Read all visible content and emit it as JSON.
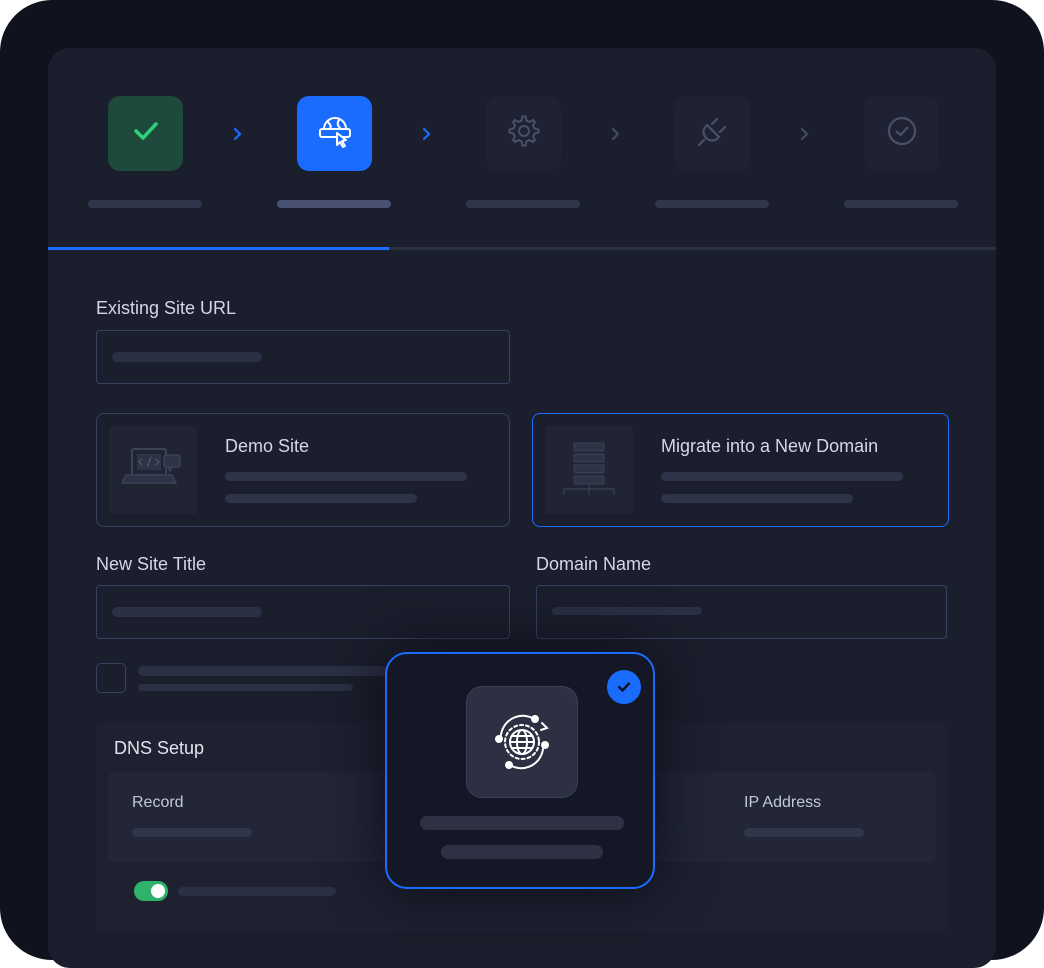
{
  "wizard": {
    "steps": [
      {
        "state": "done",
        "icon": "checkmark-icon"
      },
      {
        "state": "active",
        "icon": "globe-cursor-icon"
      },
      {
        "state": "upcoming",
        "icon": "gear-icon"
      },
      {
        "state": "upcoming",
        "icon": "plug-icon"
      },
      {
        "state": "upcoming",
        "icon": "check-circle-icon"
      }
    ],
    "progress_fraction": 0.36
  },
  "form": {
    "existing_site_url": {
      "label": "Existing Site URL"
    },
    "options": [
      {
        "title": "Demo Site",
        "selected": false,
        "icon": "laptop-code-icon"
      },
      {
        "title": "Migrate into a New Domain",
        "selected": true,
        "icon": "server-stack-icon"
      }
    ],
    "new_site_title": {
      "label": "New Site Title"
    },
    "domain_name": {
      "label": "Domain Name"
    }
  },
  "dns": {
    "title": "DNS Setup",
    "columns": [
      "Record",
      "IP Address"
    ],
    "toggle_on": true
  },
  "overlay_card": {
    "icon": "globe-sync-icon",
    "checked": true
  },
  "colors": {
    "accent": "#1a6cff",
    "success": "#2fb36b",
    "panel": "#1b1e2c"
  }
}
